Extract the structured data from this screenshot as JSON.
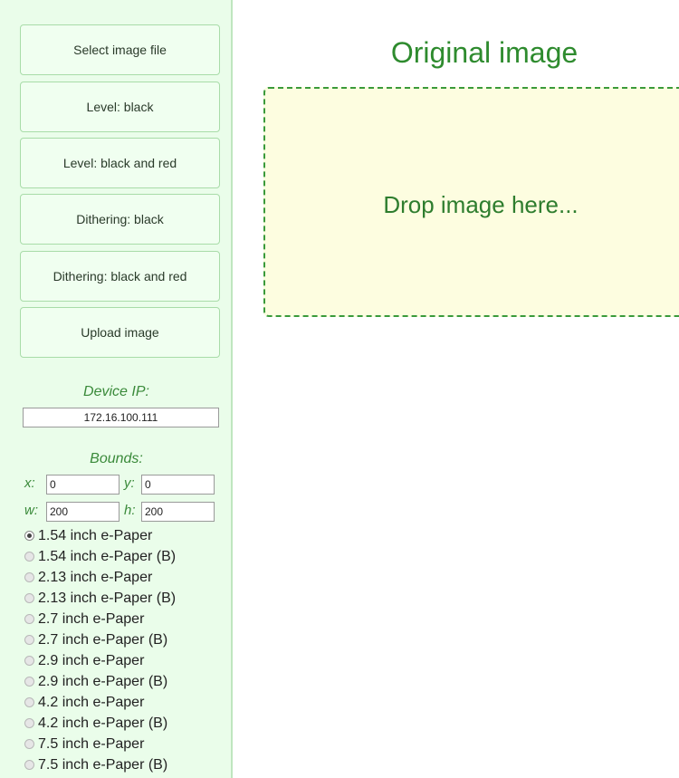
{
  "sidebar": {
    "buttons": [
      {
        "label": "Select image file"
      },
      {
        "label": "Level: black"
      },
      {
        "label": "Level: black and red"
      },
      {
        "label": "Dithering: black"
      },
      {
        "label": "Dithering: black and red"
      },
      {
        "label": "Upload image"
      }
    ],
    "device_ip_label": "Device IP:",
    "device_ip_value": "172.16.100.111",
    "bounds_label": "Bounds:",
    "bounds": {
      "x_label": "x:",
      "x_value": "0",
      "y_label": "y:",
      "y_value": "0",
      "w_label": "w:",
      "w_value": "200",
      "h_label": "h:",
      "h_value": "200"
    },
    "displays": [
      {
        "label": "1.54 inch e-Paper",
        "checked": true
      },
      {
        "label": "1.54 inch e-Paper (B)",
        "checked": false
      },
      {
        "label": "2.13 inch e-Paper",
        "checked": false
      },
      {
        "label": "2.13 inch e-Paper (B)",
        "checked": false
      },
      {
        "label": "2.7 inch e-Paper",
        "checked": false
      },
      {
        "label": "2.7 inch e-Paper (B)",
        "checked": false
      },
      {
        "label": "2.9 inch e-Paper",
        "checked": false
      },
      {
        "label": "2.9 inch e-Paper (B)",
        "checked": false
      },
      {
        "label": "4.2 inch e-Paper",
        "checked": false
      },
      {
        "label": "4.2 inch e-Paper (B)",
        "checked": false
      },
      {
        "label": "7.5 inch e-Paper",
        "checked": false
      },
      {
        "label": "7.5 inch e-Paper (B)",
        "checked": false
      }
    ]
  },
  "main": {
    "title": "Original image",
    "drop_text": "Drop image here..."
  },
  "colors": {
    "sidebar_bg": "#eafdea",
    "accent_green": "#2e8b2e",
    "dropzone_bg": "#fdfde0"
  }
}
